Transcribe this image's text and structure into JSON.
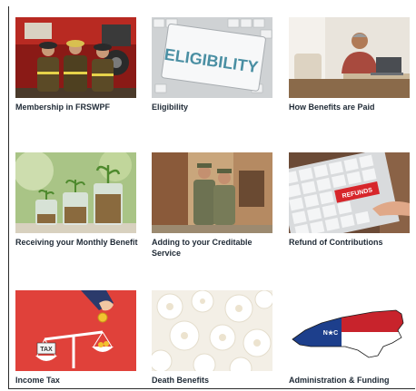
{
  "cards": [
    {
      "label": "Membership in FRSWPF",
      "image": "firefighters-photo"
    },
    {
      "label": "Eligibility",
      "image": "eligibility-keyboard-photo",
      "image_text": "ELIGIBILITY"
    },
    {
      "label": "How Benefits are Paid",
      "image": "man-at-laptop-photo"
    },
    {
      "label": "Receiving your Monthly Benefit",
      "image": "coin-jars-photo"
    },
    {
      "label": "Adding to your Creditable Service",
      "image": "soldiers-photo"
    },
    {
      "label": "Refund of Contributions",
      "image": "refunds-key-photo",
      "image_text": "REFUNDS"
    },
    {
      "label": "Income Tax",
      "image": "tax-scale-illustration",
      "image_text": "TAX"
    },
    {
      "label": "Death Benefits",
      "image": "white-flowers-photo"
    },
    {
      "label": "Administration & Funding",
      "image": "north-carolina-flag-map",
      "image_text": "N★C"
    }
  ],
  "colors": {
    "label_text": "#1f2a36",
    "tax_red": "#e0413a",
    "nc_blue": "#1d3f8c",
    "nc_red": "#c8232c"
  }
}
